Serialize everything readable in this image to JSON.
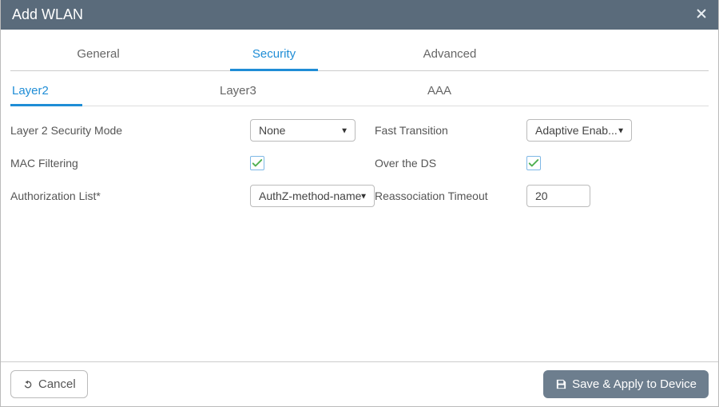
{
  "header": {
    "title": "Add WLAN"
  },
  "tabs_primary": {
    "general": "General",
    "security": "Security",
    "advanced": "Advanced",
    "active": "security"
  },
  "tabs_secondary": {
    "layer2": "Layer2",
    "layer3": "Layer3",
    "aaa": "AAA",
    "active": "layer2"
  },
  "left": {
    "l2_security_mode_label": "Layer 2 Security Mode",
    "l2_security_mode_value": "None",
    "mac_filtering_label": "MAC Filtering",
    "mac_filtering_checked": true,
    "authorization_list_label": "Authorization List*",
    "authorization_list_value": "AuthZ-method-name"
  },
  "right": {
    "fast_transition_label": "Fast Transition",
    "fast_transition_value": "Adaptive Enab...",
    "over_the_ds_label": "Over the DS",
    "over_the_ds_checked": true,
    "reassociation_timeout_label": "Reassociation Timeout",
    "reassociation_timeout_value": "20"
  },
  "footer": {
    "cancel": "Cancel",
    "save": "Save & Apply to Device"
  }
}
